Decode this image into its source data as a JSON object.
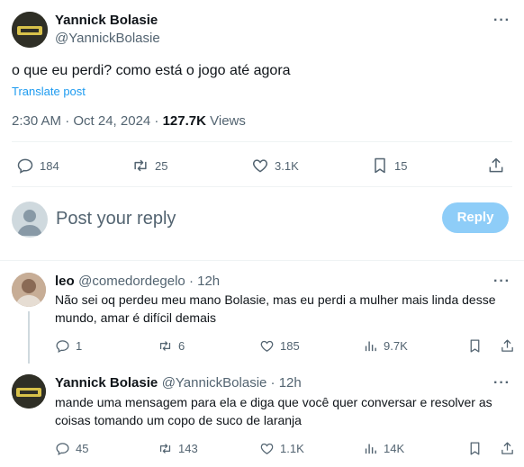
{
  "main_tweet": {
    "author_name": "Yannick Bolasie",
    "author_handle": "@YannickBolasie",
    "text": "o que eu perdi? como está o jogo até agora",
    "translate_label": "Translate post",
    "time": "2:30 AM · Oct 24, 2024 · ",
    "views_count": "127.7K",
    "views_label": " Views",
    "stats": {
      "replies": "184",
      "reposts": "25",
      "likes": "3.1K",
      "bookmarks": "15"
    }
  },
  "composer": {
    "placeholder": "Post your reply",
    "button_label": "Reply"
  },
  "replies": [
    {
      "author_name": "leo",
      "author_handle": "@comedordegelo · 12h",
      "text": "Não sei oq perdeu meu mano Bolasie, mas eu perdi a mulher mais linda desse mundo, amar é difícil demais",
      "stats": {
        "replies": "1",
        "reposts": "6",
        "likes": "185",
        "views": "9.7K"
      }
    },
    {
      "author_name": "Yannick Bolasie",
      "author_handle": "@YannickBolasie · 12h",
      "text": "mande uma mensagem para ela e diga que você quer conversar e resolver as coisas tomando um copo de suco de laranja",
      "stats": {
        "replies": "45",
        "reposts": "143",
        "likes": "1.1K",
        "views": "14K"
      }
    }
  ],
  "more_glyph": "···"
}
